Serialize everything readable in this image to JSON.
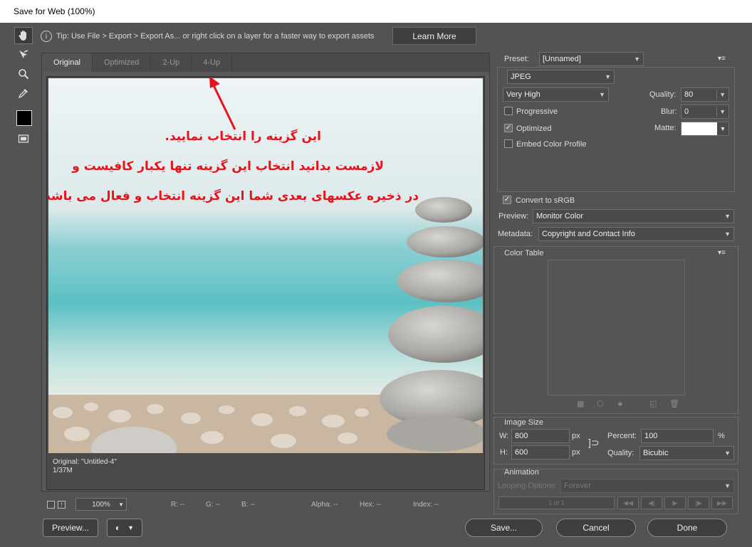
{
  "window": {
    "title": "Save for Web (100%)"
  },
  "tip": {
    "text": "Tip: Use File > Export > Export As...  or right click on a layer for a faster way to export assets",
    "button": "Learn More"
  },
  "tabs": [
    {
      "label": "Original"
    },
    {
      "label": "Optimized"
    },
    {
      "label": "2-Up"
    },
    {
      "label": "4-Up"
    }
  ],
  "annotation": {
    "line1": "این گزینه را انتخاب نمایید.",
    "line2": "لازمست بدانید انتخاب این گزینه تنها یکبار کافیست و",
    "line3": "در ذخیره عکسهای بعدی شما این گزینه انتخاب و فعال می باشد",
    "color": "#e8121b"
  },
  "photo_info": {
    "name": "Original: \"Untitled-4\"",
    "size": "1/37M"
  },
  "status": {
    "zoom": "100%",
    "r": "R: --",
    "g": "G: --",
    "b": "B: --",
    "alpha": "Alpha: --",
    "hex": "Hex: --",
    "index": "Index: --"
  },
  "buttons": {
    "preview": "Preview...",
    "save": "Save...",
    "cancel": "Cancel",
    "done": "Done"
  },
  "settings": {
    "preset_label": "Preset:",
    "preset_value": "[Unnamed]",
    "format": "JPEG",
    "compression": "Very High",
    "quality_label": "Quality:",
    "quality_value": "80",
    "progressive": "Progressive",
    "blur_label": "Blur:",
    "blur_value": "0",
    "optimized": "Optimized",
    "matte_label": "Matte:",
    "embed_profile": "Embed Color Profile",
    "convert_srgb": "Convert to sRGB",
    "preview_label": "Preview:",
    "preview_value": "Monitor Color",
    "metadata_label": "Metadata:",
    "metadata_value": "Copyright and Contact Info"
  },
  "color_table": {
    "title": "Color Table"
  },
  "image_size": {
    "title": "Image Size",
    "w_label": "W:",
    "w_value": "800",
    "w_unit": "px",
    "h_label": "H:",
    "h_value": "600",
    "h_unit": "px",
    "percent_label": "Percent:",
    "percent_value": "100",
    "percent_unit": "%",
    "quality_label": "Quality:",
    "quality_value": "Bicubic"
  },
  "animation": {
    "title": "Animation",
    "looping_label": "Looping Options:",
    "looping_value": "Forever",
    "frame_counter": "1 of 1"
  }
}
